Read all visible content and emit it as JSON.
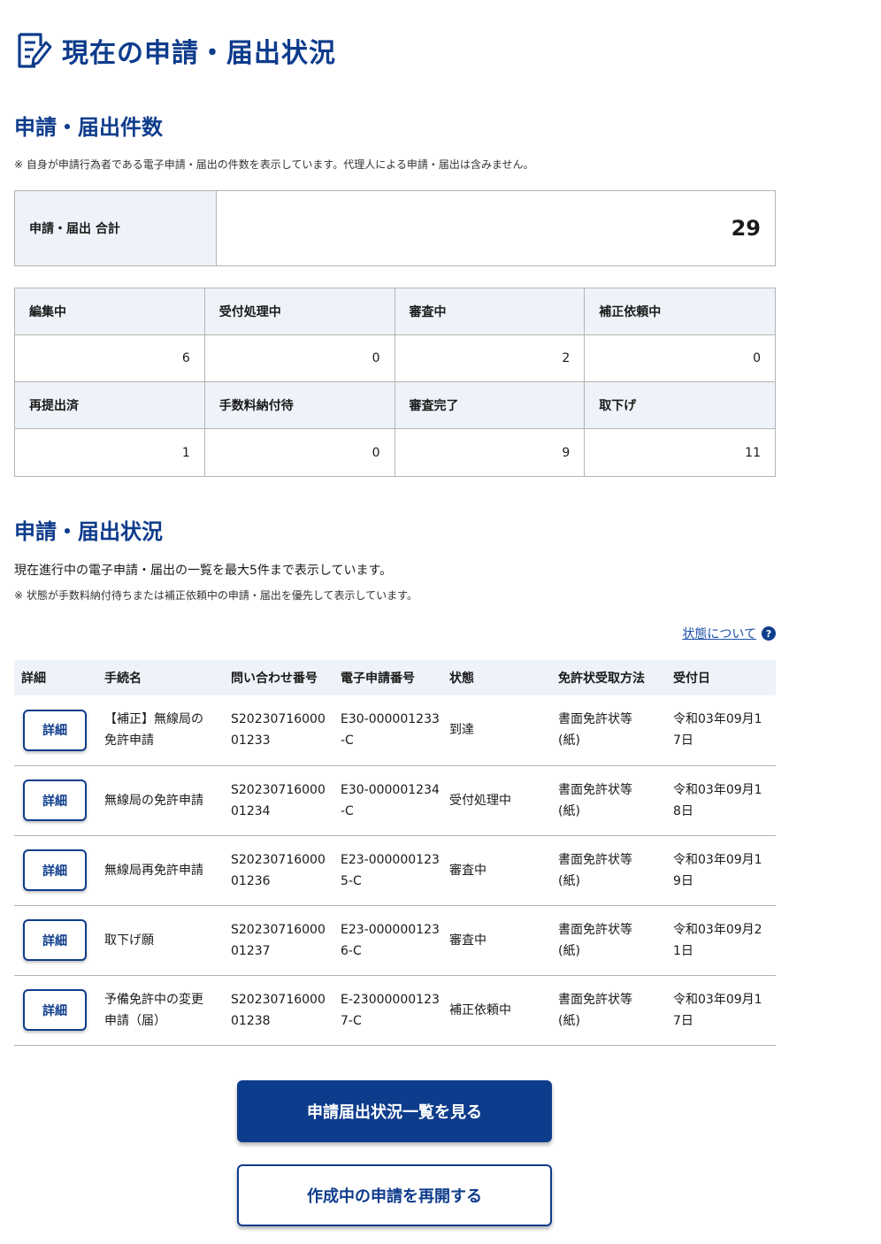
{
  "page": {
    "title": "現在の申請・届出状況",
    "icon": "document-pen-icon"
  },
  "counts_section": {
    "heading": "申請・届出件数",
    "note": "※ 自身が申請行為者である電子申請・届出の件数を表示しています。代理人による申請・届出は含みません。",
    "total_label": "申請・届出 合計",
    "total_value": "29",
    "stats": [
      {
        "label": "編集中",
        "value": "6"
      },
      {
        "label": "受付処理中",
        "value": "0"
      },
      {
        "label": "審査中",
        "value": "2"
      },
      {
        "label": "補正依頼中",
        "value": "0"
      },
      {
        "label": "再提出済",
        "value": "1"
      },
      {
        "label": "手数料納付待",
        "value": "0"
      },
      {
        "label": "審査完了",
        "value": "9"
      },
      {
        "label": "取下げ",
        "value": "11"
      }
    ]
  },
  "status_section": {
    "heading": "申請・届出状況",
    "lead": "現在進行中の電子申請・届出の一覧を最大5件まで表示しています。",
    "note": "※ 状態が手数料納付待ちまたは補正依頼中の申請・届出を優先して表示しています。",
    "status_link": "状態について",
    "help_icon": "?",
    "columns": [
      "詳細",
      "手続名",
      "問い合わせ番号",
      "電子申請番号",
      "状態",
      "免許状受取方法",
      "受付日"
    ],
    "detail_label": "詳細",
    "rows": [
      {
        "name": [
          "【補正】無線局の",
          "免許申請"
        ],
        "inquiry": [
          "S20230716000",
          "01233"
        ],
        "app_no": [
          "E30-000001233",
          "-C"
        ],
        "status": "到達",
        "method": [
          "書面免許状等",
          "(紙)"
        ],
        "date": [
          "令和03年09月1",
          "7日"
        ]
      },
      {
        "name": [
          "無線局の免許申請"
        ],
        "inquiry": [
          "S20230716000",
          "01234"
        ],
        "app_no": [
          "E30-000001234",
          "-C"
        ],
        "status": "受付処理中",
        "method": [
          "書面免許状等",
          "(紙)"
        ],
        "date": [
          "令和03年09月1",
          "8日"
        ]
      },
      {
        "name": [
          "無線局再免許申請"
        ],
        "inquiry": [
          "S20230716000",
          "01236"
        ],
        "app_no": [
          "E23-000000123",
          "5-C"
        ],
        "status": "審査中",
        "method": [
          "書面免許状等",
          "(紙)"
        ],
        "date": [
          "令和03年09月1",
          "9日"
        ]
      },
      {
        "name": [
          "取下げ願"
        ],
        "inquiry": [
          "S20230716000",
          "01237"
        ],
        "app_no": [
          "E23-000000123",
          "6-C"
        ],
        "status": "審査中",
        "method": [
          "書面免許状等",
          "(紙)"
        ],
        "date": [
          "令和03年09月2",
          "1日"
        ]
      },
      {
        "name": [
          "予備免許中の変更",
          "申請（届）"
        ],
        "inquiry": [
          "S20230716000",
          "01238"
        ],
        "app_no": [
          "E-23000000123",
          "7-C"
        ],
        "status": "補正依頼中",
        "method": [
          "書面免許状等",
          "(紙)"
        ],
        "date": [
          "令和03年09月1",
          "7日"
        ]
      }
    ]
  },
  "buttons": {
    "view_list": "申請届出状況一覧を見る",
    "resume": "作成中の申請を再開する"
  },
  "colors": {
    "accent": "#0e3c8c",
    "header_bg": "#eef3f9",
    "border": "#b4b4b4"
  }
}
